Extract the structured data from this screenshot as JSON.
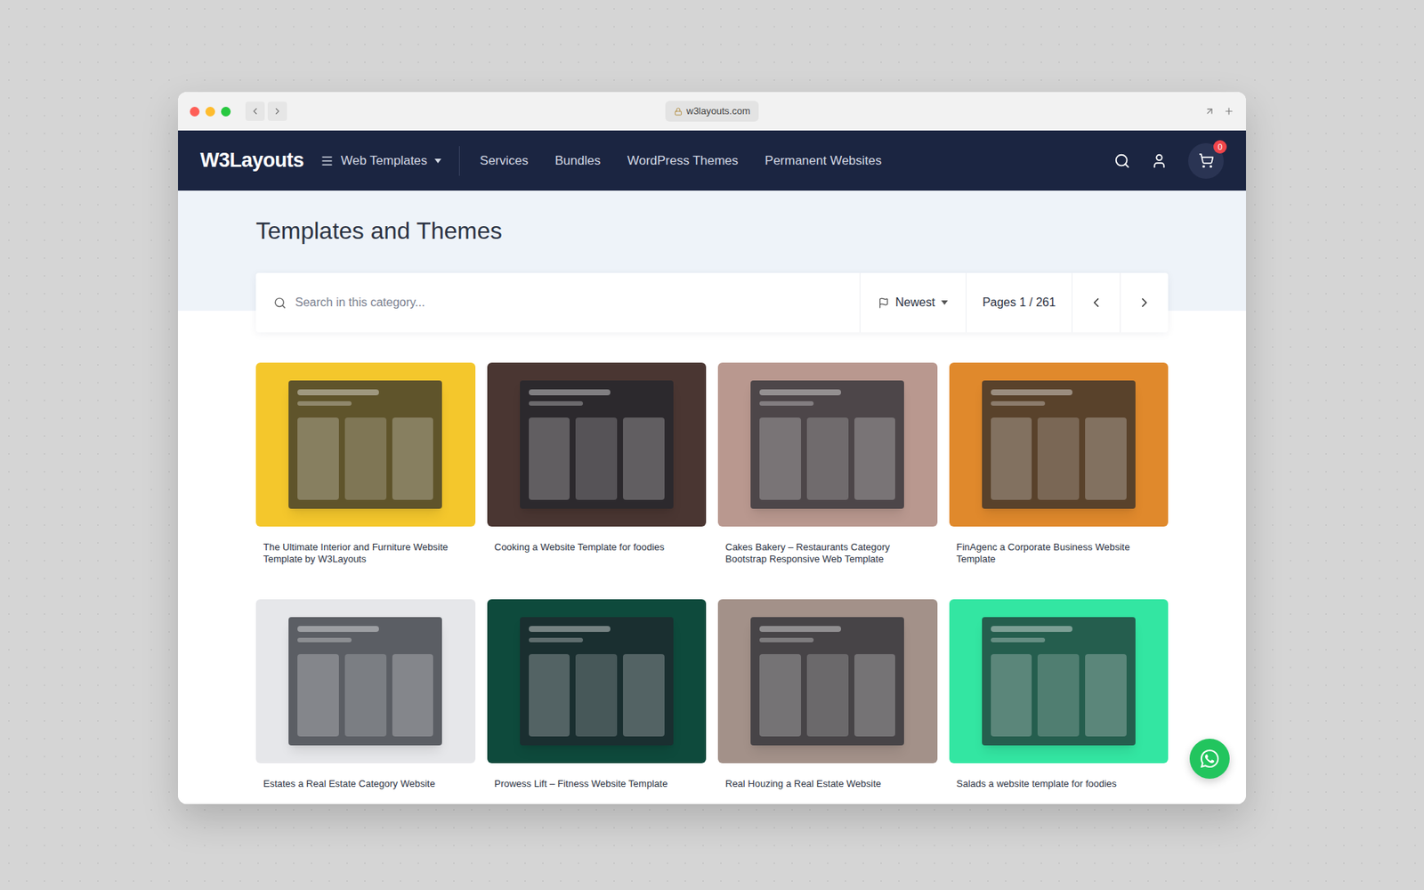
{
  "browser": {
    "url": "w3layouts.com"
  },
  "nav": {
    "logo": "W3Layouts",
    "menu": "Web Templates",
    "links": [
      "Services",
      "Bundles",
      "WordPress Themes",
      "Permanent Websites"
    ],
    "cart_count": "0"
  },
  "page": {
    "title": "Templates and Themes"
  },
  "search": {
    "placeholder": "Search in this category..."
  },
  "sort": {
    "label": "Newest"
  },
  "pagination": {
    "label": "Pages 1 / 261"
  },
  "cards": [
    {
      "title": "The Ultimate Interior and Furniture Website Template by W3Layouts",
      "color": "#f4c72c"
    },
    {
      "title": "Cooking a Website Template for foodies",
      "color": "#4a3632"
    },
    {
      "title": "Cakes Bakery – Restaurants Category Bootstrap Responsive Web Template",
      "color": "#b9988f"
    },
    {
      "title": "FinAgenc a Corporate Business Website Template",
      "color": "#e0892c"
    },
    {
      "title": "Estates a Real Estate Category Website",
      "color": "#e6e7ea"
    },
    {
      "title": "Prowess Lift – Fitness Website Template",
      "color": "#0e4a3c"
    },
    {
      "title": "Real Houzing a Real Estate Website",
      "color": "#a39189"
    },
    {
      "title": "Salads a website template for foodies",
      "color": "#33e6a2"
    }
  ]
}
